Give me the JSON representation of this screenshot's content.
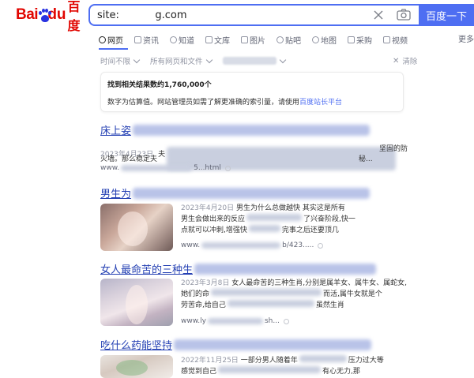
{
  "logo": {
    "part1": "Bai",
    "part2": "du",
    "cn": "百度"
  },
  "search": {
    "value": "site:       g.com",
    "button": "百度一下"
  },
  "tabs": [
    {
      "label": "网页",
      "active": true
    },
    {
      "label": "资讯"
    },
    {
      "label": "知道"
    },
    {
      "label": "文库"
    },
    {
      "label": "图片"
    },
    {
      "label": "贴吧"
    },
    {
      "label": "地图"
    },
    {
      "label": "采购"
    },
    {
      "label": "视频"
    }
  ],
  "tab_more": "更多",
  "filters": {
    "time": "时间不限",
    "type": "所有网页和文件",
    "clear": "清除"
  },
  "info": {
    "count": "找到相关结果数约1,760,000个",
    "desc_prefix": "数字为估算值。网站管理员如需了解更准确的索引量，请使用",
    "desc_link": "百度站长平台"
  },
  "results": [
    {
      "title": "床上姿",
      "date": "2023年4月23日",
      "lead": "夫",
      "text_tail": "坚固的防",
      "line2_start": "火墙。那么稳定夫",
      "line2_end": "秘...",
      "url_start": "www.",
      "url_end": "5...html"
    },
    {
      "title": "男生为",
      "date": "2023年4月20日",
      "text1_mid": "男生为什么总做越快",
      "text1_end": "其实这是所有",
      "text2_start": "男生会做出来的反应",
      "text2_end": "了兴奋阶段,快一",
      "text3": "点就可以冲刺,增强快",
      "text3_end": "完事之后还要顶几",
      "url_start": "www.",
      "url_end": "b/423....."
    },
    {
      "title": "女人最命苦的三种生",
      "date": "2023年3月8日",
      "text1_mid": "女人最命苦的三种生肖,分别是属羊女、属牛女、属蛇女,",
      "text2_start": "她们的命",
      "text2_end": "而活,属牛女就是个",
      "text3": "劳苦命,给自己",
      "text3_end": "虽然生肖",
      "url_start": "www.ly",
      "url_end": "sh..."
    },
    {
      "title": "吃什么药能坚持",
      "date": "2022年11月25日",
      "text1_mid": "一部分男人随着年",
      "text1_end": "压力过大等",
      "text2_start": "感觉到自己",
      "text2_end": "有心无力,那"
    }
  ]
}
